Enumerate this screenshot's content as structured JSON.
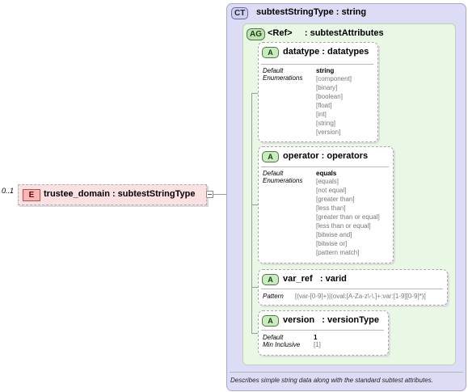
{
  "element": {
    "occurrence": "0..1",
    "badge": "E",
    "name": "trustee_domain : subtestStringType"
  },
  "complex_type": {
    "badge": "CT",
    "name": "subtestStringType : string",
    "description": "Describes simple string data along with the standard subtest attributes."
  },
  "attribute_group": {
    "badge": "AG",
    "name": "<Ref>     : subtestAttributes"
  },
  "attributes": [
    {
      "badge": "A",
      "name": "datatype : datatypes",
      "labels": [
        "Default",
        "Enumerations"
      ],
      "default": "string",
      "enumerations": [
        "[component]",
        "[binary]",
        "[boolean]",
        "[float]",
        "[int]",
        "[string]",
        "[version]"
      ]
    },
    {
      "badge": "A",
      "name": "operator : operators",
      "labels": [
        "Default",
        "Enumerations"
      ],
      "default": "equals",
      "enumerations": [
        "[equals]",
        "[not equal]",
        "[greater than]",
        "[less than]",
        "[greater than or equal]",
        "[less than or equal]",
        "[bitwise and]",
        "[bitwise or]",
        "[pattern match]"
      ]
    },
    {
      "badge": "A",
      "name": "var_ref   : varid",
      "labels": [
        "Pattern"
      ],
      "pattern": "[(var-[0-9]+)|(oval:[A-Za-z\\-\\.]+:var:[1-9][0-9]*)]"
    },
    {
      "badge": "A",
      "name": "version   : versionType",
      "labels": [
        "Default",
        "Min Inclusive"
      ],
      "default": "1",
      "min_inclusive": "[1]"
    }
  ]
}
